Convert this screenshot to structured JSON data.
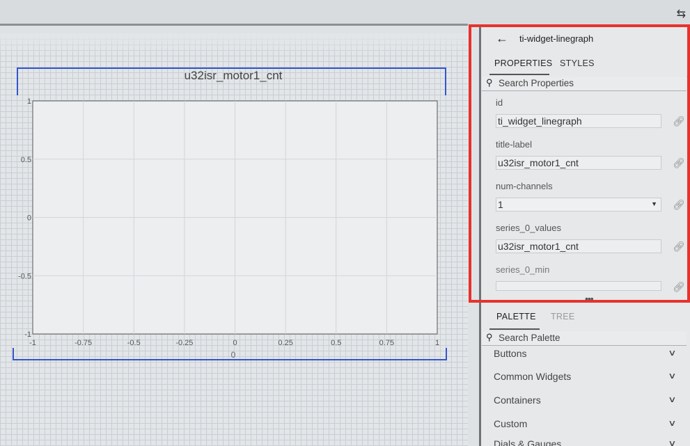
{
  "header": {
    "swap_icon": "swap-arrows-icon"
  },
  "widget": {
    "title": "u32isr_motor1_cnt",
    "x_axis_title": "0"
  },
  "chart_data": {
    "type": "line",
    "title": "u32isr_motor1_cnt",
    "xlabel": "0",
    "ylabel": "",
    "xlim": [
      -1,
      1
    ],
    "ylim": [
      -1,
      1
    ],
    "x_ticks": [
      "-1",
      "-0.75",
      "-0.5",
      "-0.25",
      "0",
      "0.25",
      "0.5",
      "0.75",
      "1"
    ],
    "y_ticks": [
      "1",
      "0.5",
      "0",
      "-0.5",
      "-1"
    ],
    "grid": true,
    "series": []
  },
  "panel": {
    "back_icon": "arrow-left-icon",
    "widget_name": "ti-widget-linegraph",
    "tabs": {
      "properties": "PROPERTIES",
      "styles": "STYLES"
    },
    "search_properties_placeholder": "Search Properties",
    "properties": {
      "id": {
        "label": "id",
        "value": "ti_widget_linegraph"
      },
      "title_label": {
        "label": "title-label",
        "value": "u32isr_motor1_cnt"
      },
      "num_channels": {
        "label": "num-channels",
        "value": "1"
      },
      "series_0_values": {
        "label": "series_0_values",
        "value": "u32isr_motor1_cnt"
      },
      "series_0_min": {
        "label": "series_0_min",
        "value": ""
      }
    },
    "splitter": "•••",
    "palette_tabs": {
      "palette": "PALETTE",
      "tree": "TREE"
    },
    "search_palette_placeholder": "Search Palette",
    "categories": [
      {
        "label": "Buttons"
      },
      {
        "label": "Common Widgets"
      },
      {
        "label": "Containers"
      },
      {
        "label": "Custom"
      },
      {
        "label": "Dials & Gauges"
      }
    ],
    "highlight_color": "#e8322c"
  }
}
